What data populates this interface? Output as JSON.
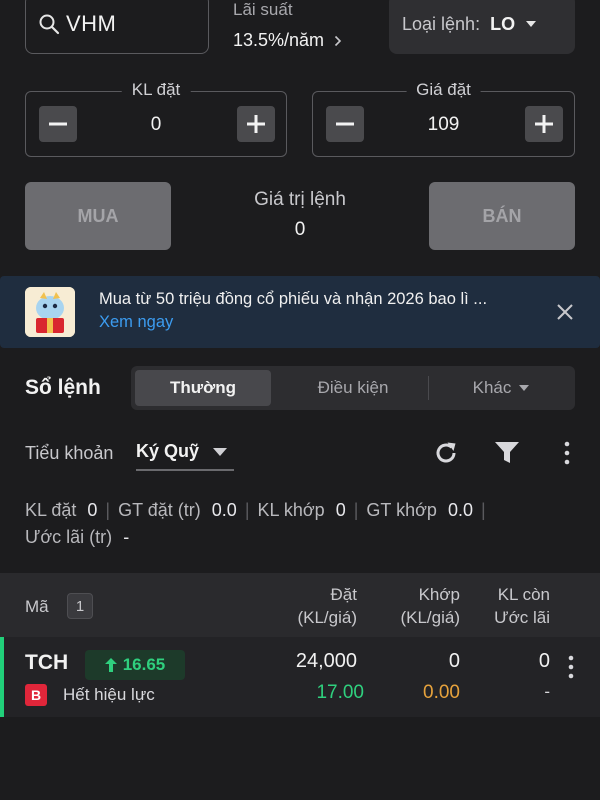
{
  "search": {
    "value": "VHM",
    "icon": "search-icon"
  },
  "interest": {
    "label": "Lãi suất",
    "value": "13.5%/năm"
  },
  "order_type": {
    "label": "Loại lệnh:",
    "value": "LO"
  },
  "quantity": {
    "label": "KL đặt",
    "value": "0"
  },
  "price": {
    "label": "Giá đặt",
    "value": "109"
  },
  "buy_label": "MUA",
  "sell_label": "BÁN",
  "order_value": {
    "label": "Giá trị lệnh",
    "value": "0"
  },
  "banner": {
    "text": "Mua từ 50 triệu đồng cổ phiếu và nhận 2026 bao lì ...",
    "link": "Xem ngay"
  },
  "order_book": {
    "title": "Sổ lệnh",
    "tabs": [
      "Thường",
      "Điều kiện",
      "Khác"
    ],
    "subaccount_label": "Tiểu khoản",
    "subaccount_value": "Ký Quỹ"
  },
  "stats": {
    "kl_dat_label": "KL đặt",
    "kl_dat": "0",
    "gt_dat_label": "GT đặt (tr)",
    "gt_dat": "0.0",
    "kl_khop_label": "KL khớp",
    "kl_khop": "0",
    "gt_khop_label": "GT khớp",
    "gt_khop": "0.0",
    "uoc_lai_label": "Ước lãi (tr)",
    "uoc_lai": "-"
  },
  "table": {
    "col_code": "Mã",
    "count": "1",
    "col_order_1": "Đặt",
    "col_order_2": "(KL/giá)",
    "col_match_1": "Khớp",
    "col_match_2": "(KL/giá)",
    "col_remain_1": "KL còn",
    "col_remain_2": "Ước lãi",
    "rows": [
      {
        "symbol": "TCH",
        "change": "16.65",
        "side": "B",
        "status": "Hết hiệu lực",
        "order_qty": "24,000",
        "order_price": "17.00",
        "match_qty": "0",
        "match_price": "0.00",
        "remain": "0",
        "profit": "-"
      }
    ]
  },
  "colors": {
    "up": "#2fd07e",
    "buy": "#e0263a",
    "link": "#3c9cf0",
    "match": "#e6a23c"
  }
}
